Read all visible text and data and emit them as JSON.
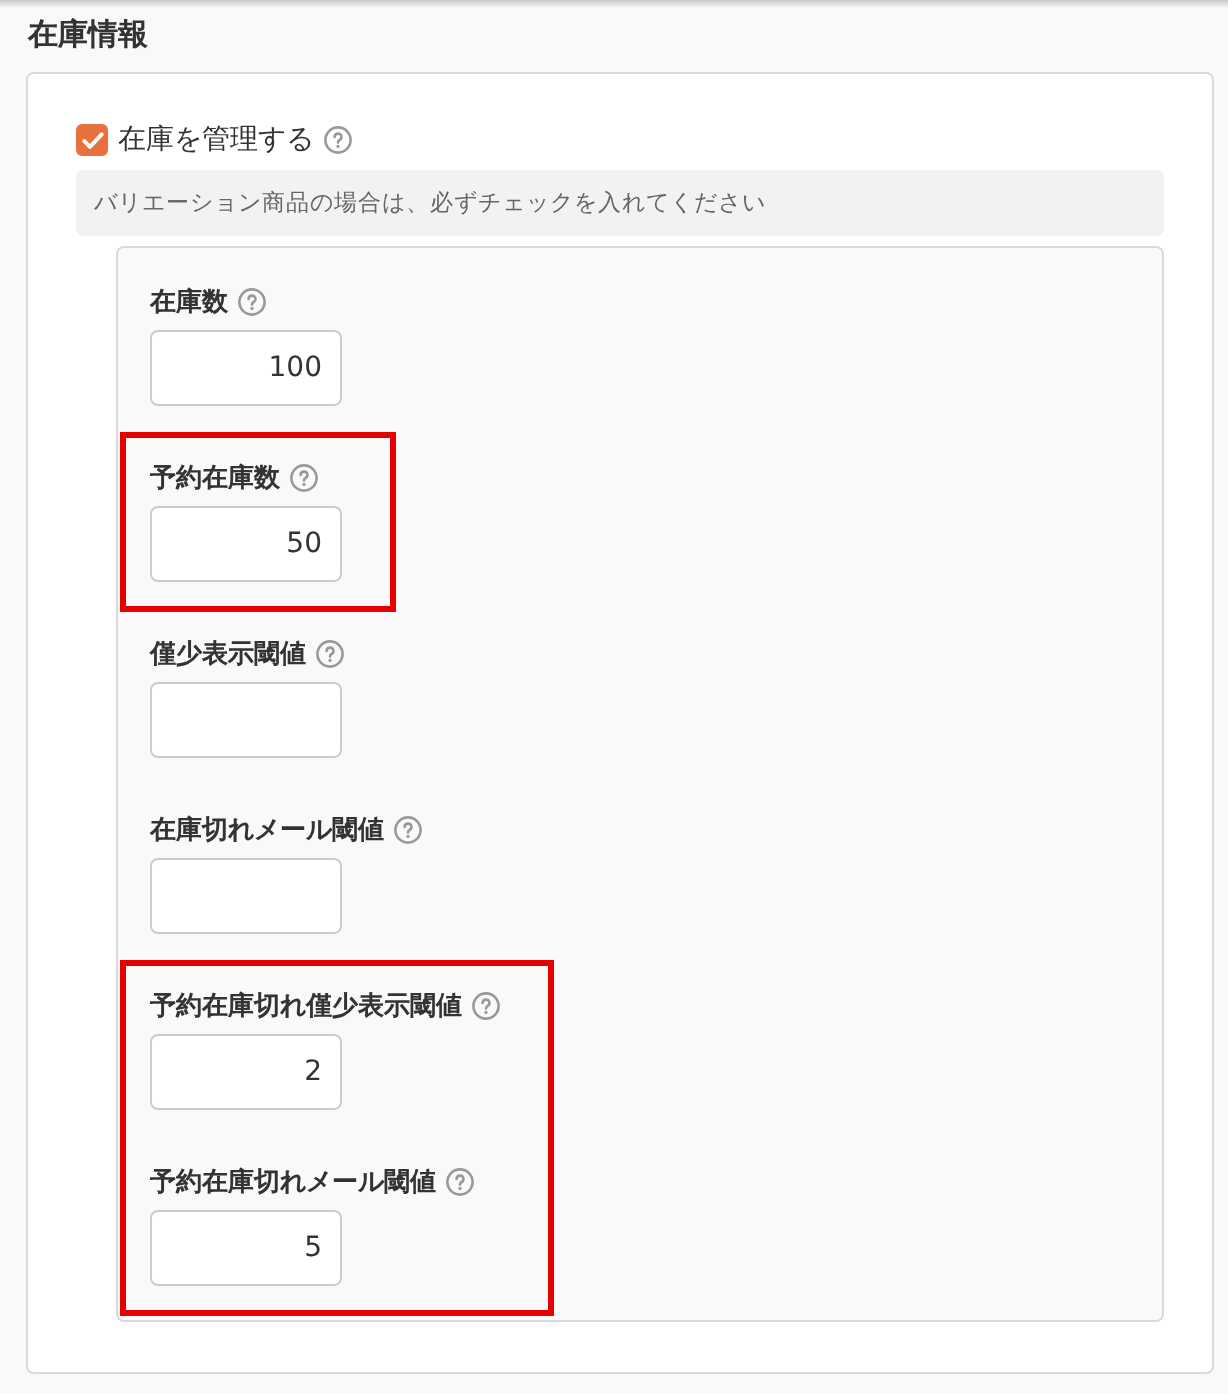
{
  "section_title": "在庫情報",
  "manage_stock": {
    "label": "在庫を管理する",
    "checked": true
  },
  "note": "バリエーション商品の場合は、必ずチェックを入れてください",
  "field_groups": [
    {
      "highlighted": false,
      "fields": [
        {
          "label": "在庫数",
          "value": "100"
        }
      ]
    },
    {
      "highlighted": true,
      "fields": [
        {
          "label": "予約在庫数",
          "value": "50"
        }
      ]
    },
    {
      "highlighted": false,
      "fields": [
        {
          "label": "僅少表示閾値"
        },
        {
          "label": "在庫切れメール閾値"
        }
      ]
    },
    {
      "highlighted": true,
      "fields": [
        {
          "label": "予約在庫切れ僅少表示閾値",
          "value": "2"
        },
        {
          "label": "予約在庫切れメール閾値",
          "value": "5"
        }
      ]
    }
  ]
}
